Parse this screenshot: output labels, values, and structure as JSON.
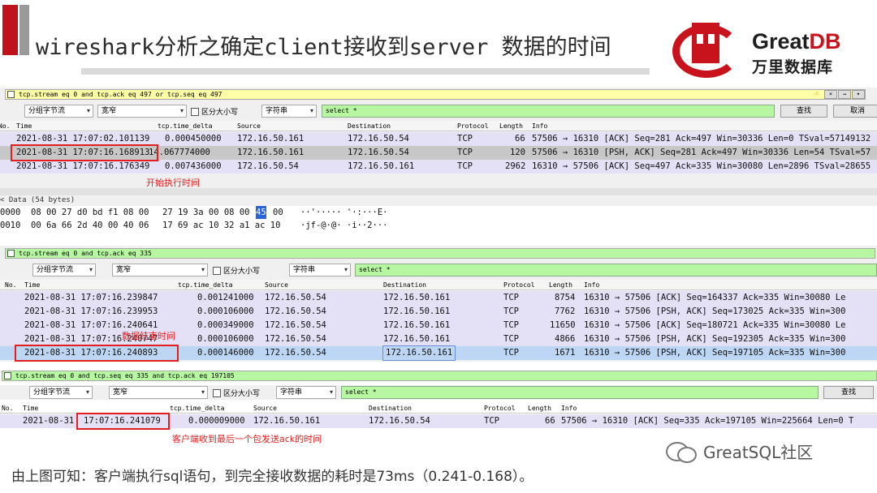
{
  "header": {
    "title": "wireshark分析之确定client接收到server 数据的时间",
    "logo_en": "Great",
    "logo_en_db": "DB",
    "logo_cn": "万里数据库"
  },
  "pane1": {
    "filter": "tcp.stream eq 0 and tcp.ack eq 497 or tcp.seq eq 497",
    "toolbar": {
      "select1": "分组字节流",
      "select2": "宽窄",
      "checkbox": "区分大小写",
      "select3": "字符串",
      "search_value": "select *",
      "find_button": "查找",
      "cancel_button": "取消"
    },
    "columns": [
      "No.",
      "Time",
      "tcp.time_delta",
      "Source",
      "Destination",
      "Protocol",
      "Length",
      "Info"
    ],
    "rows": [
      {
        "time": "2021-08-31 17:07:02.101139",
        "delta": "0.000450000",
        "src": "172.16.50.161",
        "dst": "172.16.50.54",
        "proto": "TCP",
        "len": "66",
        "info": "57506 → 16310 [ACK] Seq=281 Ack=497 Win=30336 Len=0 TSval=57149132"
      },
      {
        "time": "2021-08-31 17:07:16.168913",
        "delta": "14.067774000",
        "src": "172.16.50.161",
        "dst": "172.16.50.54",
        "proto": "TCP",
        "len": "120",
        "info": "57506 → 16310 [PSH, ACK] Seq=281 Ack=497 Win=30336 Len=54 TSval=57"
      },
      {
        "time": "2021-08-31 17:07:16.176349",
        "delta": "0.007436000",
        "src": "172.16.50.54",
        "dst": "172.16.50.161",
        "proto": "TCP",
        "len": "2962",
        "info": "16310 → 57506 [ACK] Seq=497 Ack=335 Win=30080 Len=2896 TSval=28655"
      }
    ],
    "annotation": "开始执行时间",
    "detail_label": "< Data (54 bytes)",
    "hex": [
      {
        "offset": "0000",
        "bytes_a": "08 00 27 d0 bd f1 08 00",
        "bytes_b": "27 19 3a 00 08 00",
        "sel": "45",
        "bytes_c": "00",
        "ascii": "··'·····  '·:···E·"
      },
      {
        "offset": "0010",
        "bytes_a": "00 6a 66 2d 40 00 40 06",
        "bytes_b": "17 69 ac 10 32 a1 ac 10",
        "sel": "",
        "bytes_c": "",
        "ascii": "·jf-@·@·  ·i··2···"
      }
    ]
  },
  "pane2": {
    "filter": "tcp.stream eq 0 and tcp.ack eq 335",
    "toolbar": {
      "select1": "分组字节流",
      "select2": "宽窄",
      "checkbox": "区分大小写",
      "select3": "字符串",
      "search_value": "select *"
    },
    "columns": [
      "No.",
      "Time",
      "tcp.time_delta",
      "Source",
      "Destination",
      "Protocol",
      "Length",
      "Info"
    ],
    "rows": [
      {
        "time": "2021-08-31 17:07:16.239847",
        "delta": "0.001241000",
        "src": "172.16.50.54",
        "dst": "172.16.50.161",
        "proto": "TCP",
        "len": "8754",
        "info": "16310 → 57506 [ACK] Seq=164337 Ack=335 Win=30080 Le"
      },
      {
        "time": "2021-08-31 17:07:16.239953",
        "delta": "0.000106000",
        "src": "172.16.50.54",
        "dst": "172.16.50.161",
        "proto": "TCP",
        "len": "7762",
        "info": "16310 → 57506 [PSH, ACK] Seq=173025 Ack=335 Win=300"
      },
      {
        "time": "2021-08-31 17:07:16.240641",
        "delta": "0.000349000",
        "src": "172.16.50.54",
        "dst": "172.16.50.161",
        "proto": "TCP",
        "len": "11650",
        "info": "16310 → 57506 [ACK] Seq=180721 Ack=335 Win=30080 Le"
      },
      {
        "time": "2021-08-31 17:07:16.240747",
        "delta": "0.000106000",
        "src": "172.16.50.54",
        "dst": "172.16.50.161",
        "proto": "TCP",
        "len": "4866",
        "info": "16310 → 57506 [PSH, ACK] Seq=192305 Ack=335 Win=300"
      },
      {
        "time": "2021-08-31 17:07:16.240893",
        "delta": "0.000146000",
        "src": "172.16.50.54",
        "dst": "172.16.50.161",
        "proto": "TCP",
        "len": "1671",
        "info": "16310 → 57506 [PSH, ACK] Seq=197105 Ack=335 Win=300"
      }
    ],
    "annotation": "数据结束时间"
  },
  "pane3": {
    "filter": "tcp.stream eq 0 and tcp.seq eq 335 and tcp.ack eq 197105",
    "toolbar": {
      "select1": "分组字节流",
      "select2": "宽窄",
      "checkbox": "区分大小写",
      "select3": "字符串",
      "search_value": "select *",
      "find_button": "查找"
    },
    "columns": [
      "No.",
      "Time",
      "tcp.time_delta",
      "Source",
      "Destination",
      "Protocol",
      "Length",
      "Info"
    ],
    "rows": [
      {
        "time_date": "2021-08-31",
        "time_clock": "17:07:16.241079",
        "delta": "0.000009000",
        "src": "172.16.50.161",
        "dst": "172.16.50.54",
        "proto": "TCP",
        "len": "66",
        "info": "57506 → 16310 [ACK] Seq=335 Ack=197105 Win=225664 Len=0 T"
      }
    ],
    "annotation": "客户端收到最后一个包发送ack的时间"
  },
  "footer": {
    "note": "由上图可知：客户端执行sql语句，到完全接收数据的耗时是73ms（0.241-0.168）。",
    "watermark": "GreatSQL社区"
  },
  "colors": {
    "accent_red": "#e41e1e",
    "brand_red": "#c8121c",
    "filter_yellow": "#ffffa8",
    "filter_green": "#b7f7a2",
    "row_lavender": "#e4e0f6",
    "row_selected_blue": "#bcd6f4"
  }
}
